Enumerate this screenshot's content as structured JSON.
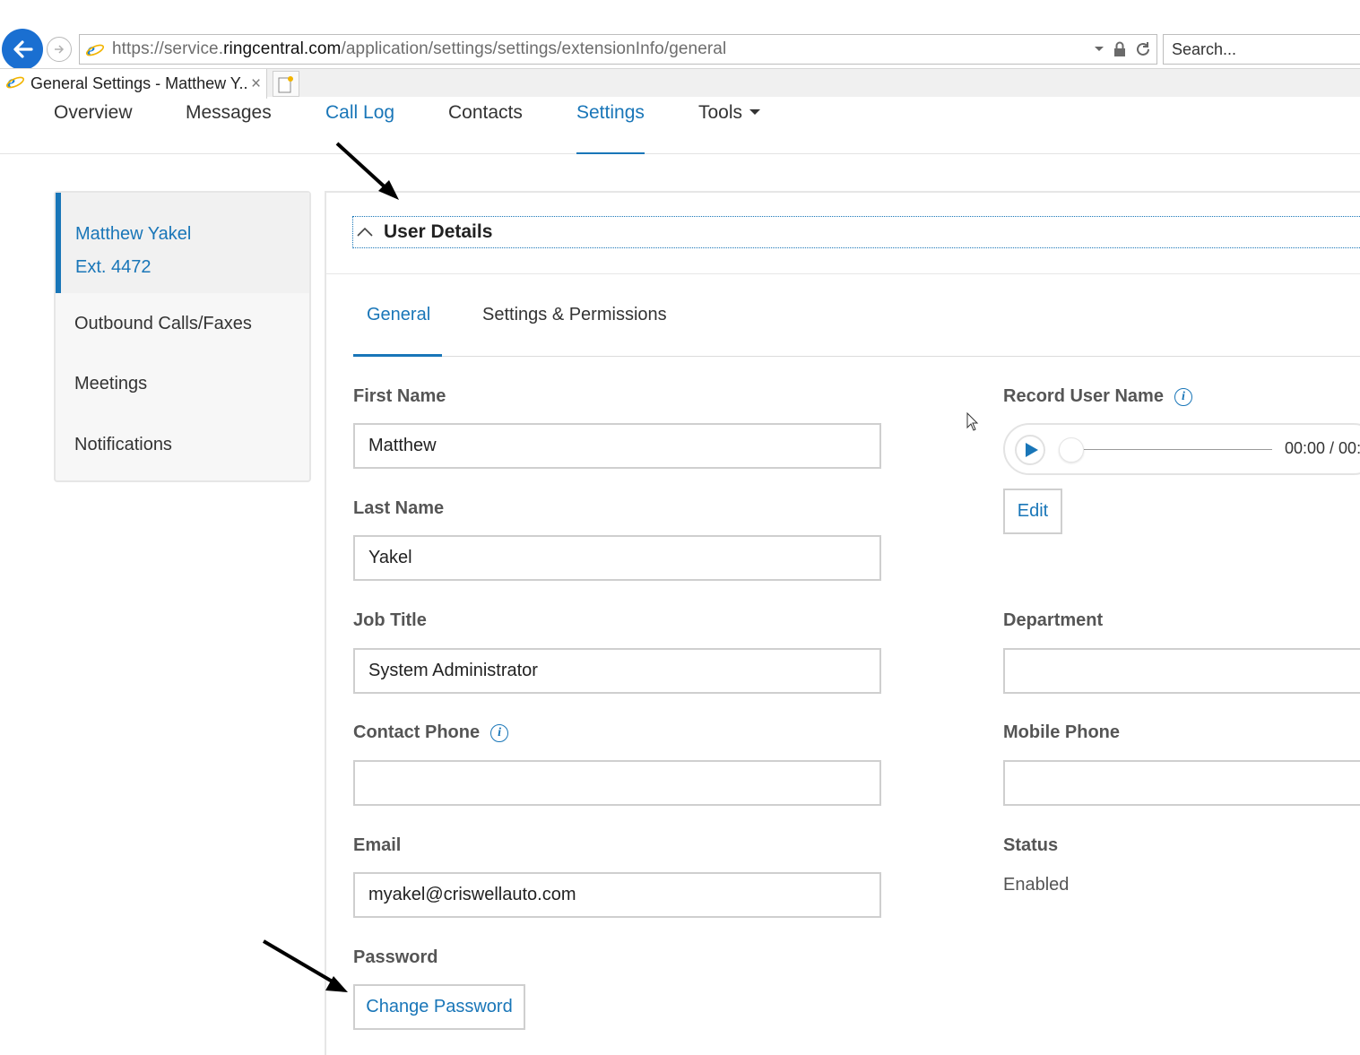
{
  "browser": {
    "url_prefix": "https://service.",
    "url_domain": "ringcentral.com",
    "url_path": "/application/settings/settings/extensionInfo/general",
    "search_placeholder": "Search...",
    "tab_title": "General Settings - Matthew Y...",
    "tab_close": "×"
  },
  "nav": {
    "items": [
      {
        "label": "Overview"
      },
      {
        "label": "Messages"
      },
      {
        "label": "Call Log"
      },
      {
        "label": "Contacts"
      },
      {
        "label": "Settings"
      },
      {
        "label": "Tools"
      }
    ]
  },
  "sidebar": {
    "user_name": "Matthew Yakel",
    "extension": "Ext. 4472",
    "items": [
      {
        "label": "Outbound Calls/Faxes"
      },
      {
        "label": "Meetings"
      },
      {
        "label": "Notifications"
      }
    ]
  },
  "section": {
    "title": "User Details",
    "tabs": [
      {
        "label": "General"
      },
      {
        "label": "Settings & Permissions"
      }
    ]
  },
  "form": {
    "first_name_label": "First Name",
    "first_name_value": "Matthew",
    "last_name_label": "Last Name",
    "last_name_value": "Yakel",
    "job_title_label": "Job Title",
    "job_title_value": "System Administrator",
    "contact_phone_label": "Contact Phone",
    "contact_phone_value": "",
    "email_label": "Email",
    "email_value": "myakel@criswellauto.com",
    "password_label": "Password",
    "change_password_label": "Change Password",
    "record_user_name_label": "Record User Name",
    "player_time": "00:00 / 00:",
    "edit_label": "Edit",
    "department_label": "Department",
    "department_value": "",
    "mobile_phone_label": "Mobile Phone",
    "mobile_phone_value": "",
    "status_label": "Status",
    "status_value": "Enabled",
    "info_glyph": "i"
  },
  "colors": {
    "accent": "#1976b8",
    "browser_back": "#1a6fd1"
  }
}
